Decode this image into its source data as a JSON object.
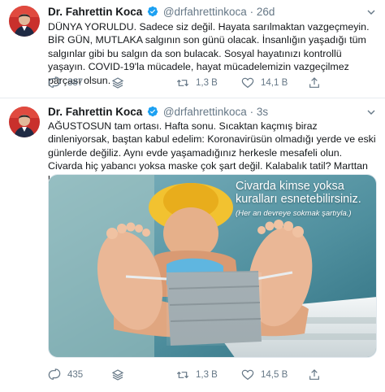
{
  "tweets": [
    {
      "author_name": "Dr. Fahrettin Koca",
      "handle": "@drfahrettinkoca",
      "separator": "·",
      "time": "26d",
      "text": "DÜNYA YORULDU. Sadece siz değil. Hayata sarılmaktan vazgeçmeyin. BİR GÜN, MUTLAKA salgının son günü olacak. İnsanlığın yaşadığı tüm salgınlar gibi bu salgın da son bulacak. Sosyal hayatınızı kontrollü yaşayın. COVID-19'la mücadele, hayat mücadelemizin vazgeçilmez parçası olsun.",
      "replies": "387",
      "retweets": "1,3 B",
      "likes": "14,1 B"
    },
    {
      "author_name": "Dr. Fahrettin Koca",
      "handle": "@drfahrettinkoca",
      "separator": "·",
      "time": "3s",
      "text": "AĞUSTOSUN tam ortası. Hafta sonu. Sıcaktan kaçmış biraz dinleniyorsak, baştan kabul edelim: Koronavirüsün olmadığı yerde ve eski günlerde değiliz. Aynı evde yaşamadığınız herkesle mesafeli olun. Civarda hiç yabancı yoksa maske çok şart değil. Kalabalık tatil? Marttan beri riskli.",
      "image_caption": "Civarda kimse yoksa kuralları esnetebilirsiniz.",
      "image_subcaption": "(Her an devreye sokmak şartıyla.)",
      "replies": "435",
      "retweets": "1,3 B",
      "likes": "14,5 B"
    }
  ],
  "colors": {
    "text": "#14171a",
    "muted": "#657786",
    "verified": "#1da1f2",
    "border": "#e6ecf0"
  }
}
